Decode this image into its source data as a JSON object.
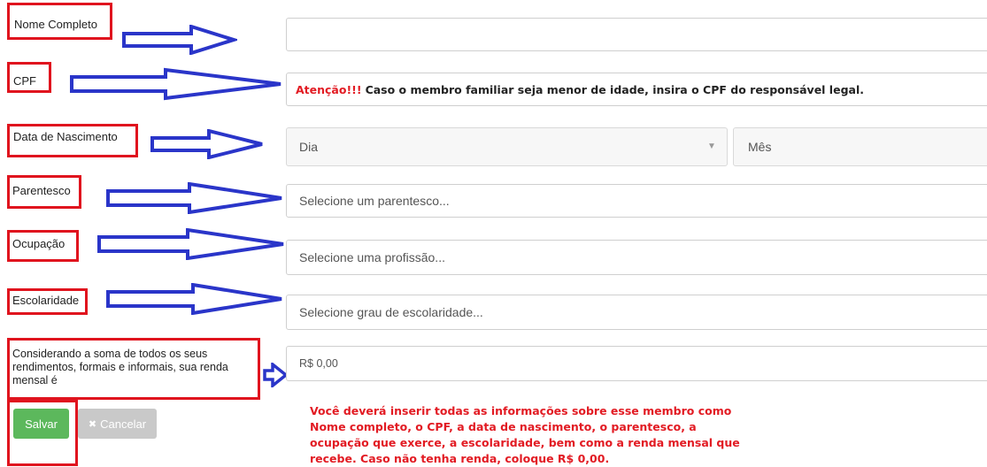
{
  "labels": {
    "nome": "Nome Completo",
    "cpf": "CPF",
    "nascimento": "Data de Nascimento",
    "parentesco": "Parentesco",
    "ocupacao": "Ocupação",
    "escolaridade": "Escolaridade",
    "renda": "Considerando a soma de todos os seus rendimentos, formais e informais, sua renda mensal é"
  },
  "fields": {
    "nome_value": "",
    "cpf_warning_prefix": "Atenção!!!",
    "cpf_warning_text": "Caso o membro familiar seja menor de idade, insira o CPF do responsável legal.",
    "dia_placeholder": "Dia",
    "mes_placeholder": "Mês",
    "parentesco_placeholder": "Selecione um parentesco...",
    "ocupacao_placeholder": "Selecione uma profissão...",
    "escolaridade_placeholder": "Selecione grau de escolaridade...",
    "renda_value": "R$  0,00"
  },
  "buttons": {
    "salvar": "Salvar",
    "cancelar": "Cancelar",
    "cancelar_icon": "times-icon"
  },
  "note": "Você deverá inserir todas as informações sobre esse membro como Nome completo, o CPF, a data de nascimento, o parentesco, a ocupação que exerce, a escolaridade, bem como a renda mensal que recebe. Caso não tenha renda, coloque R$ 0,00.",
  "colors": {
    "highlight_red": "#e0141e",
    "arrow_blue": "#2a35c9",
    "save_green": "#5cb85c",
    "cancel_gray": "#c9c9c9",
    "warning_red": "#e21b23"
  }
}
